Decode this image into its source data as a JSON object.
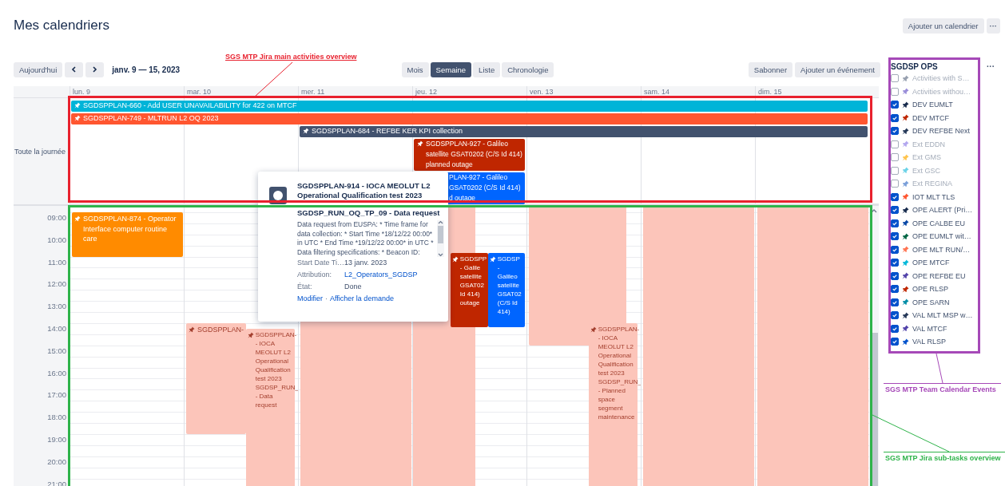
{
  "header": {
    "title": "Mes calendriers",
    "add_calendar": "Ajouter un calendrier",
    "more": "···"
  },
  "toolbar": {
    "today": "Aujourd'hui",
    "range": "janv. 9 — 15, 2023",
    "views": [
      {
        "label": "Mois",
        "selected": false
      },
      {
        "label": "Semaine",
        "selected": true
      },
      {
        "label": "Liste",
        "selected": false
      },
      {
        "label": "Chronologie",
        "selected": false
      }
    ],
    "subscribe": "Sabonner",
    "add_event": "Ajouter un événement"
  },
  "calendar": {
    "all_day_label": "Toute la journée",
    "hours": [
      "09:00",
      "10:00",
      "11:00",
      "12:00",
      "13:00",
      "14:00",
      "15:00",
      "16:00",
      "17:00",
      "18:00",
      "19:00",
      "20:00",
      "21:00"
    ],
    "days": [
      {
        "label": "lun. 9",
        "all_day": [
          {
            "color": "#00b4d8",
            "icon": true,
            "covered": false,
            "continues": true,
            "lines": [
              "SGDSPPLAN-660 - Add USER UNAVAILABILITY for 422 on MTCF"
            ]
          },
          {
            "color": "#ff5630",
            "icon": true,
            "covered": false,
            "continues": true,
            "lines": [
              "SGDSPPLAN-749 - MLTRUN L2 OQ 2023"
            ]
          }
        ],
        "events": [
          {
            "color": "#ff8b00",
            "icon": true,
            "lines": [
              "SGDSPPLAN-874 - Operator",
              "Interface computer routine",
              "care"
            ]
          }
        ]
      },
      {
        "label": "mar. 10",
        "events": [
          {
            "color": "#fcc5ba",
            "icon": true,
            "lines": [
              "SGDSPPLAN-"
            ]
          },
          {
            "color": "#fcc5ba",
            "icon": true,
            "lines": [
              "SGDSPPLAN-",
              "- IOCA",
              "MEOLUT L2",
              "Operational",
              "Qualification",
              "test 2023",
              "SGDSP_RUN_",
              "- Data",
              "request"
            ]
          }
        ]
      },
      {
        "label": "mer. 11",
        "all_day": [
          {
            "color": "#42526e",
            "icon": true,
            "covered": false,
            "continues": true,
            "lines": [
              "SGDSPPLAN-684 - REFBE KER KPI collection"
            ]
          }
        ],
        "events": [
          {
            "color": "#fcc5ba"
          }
        ]
      },
      {
        "label": "jeu. 12",
        "all_day": [
          {
            "color": "#bf2600",
            "icon": true,
            "covered": false,
            "continues": false,
            "lines": [
              "SGDSPPLAN-927 - Galileo",
              "satellite GSAT0202 (C/S Id 414)",
              "planned outage"
            ]
          },
          {
            "color": "#0065ff",
            "icon": false,
            "covered": true,
            "continues": false,
            "lines": [
              "PLAN-927 - Galileo",
              "GSAT0202 (C/S Id 414)",
              "d outage"
            ]
          }
        ],
        "events": [
          {
            "color": "#fcc5ba"
          },
          {
            "color": "#bf2600",
            "icon": true,
            "lines": [
              "SGDSPP",
              "- Galile",
              "satellite",
              "GSAT02",
              "Id 414)",
              "outage"
            ]
          },
          {
            "color": "#0065ff",
            "icon": true,
            "lines": [
              "SGDSP",
              "-",
              "Galileo",
              "satellite",
              "GSAT02",
              "(C/S Id",
              "414)"
            ]
          }
        ]
      },
      {
        "label": "ven. 13",
        "events": [
          {
            "color": "#fcc5ba"
          },
          {
            "color": "#fcc5ba",
            "icon": true,
            "lines": [
              "SGDSPPLAN-",
              "- IOCA",
              "MEOLUT L2",
              "Operational",
              "Qualification",
              "test 2023",
              "SGDSP_RUN_",
              "- Planned",
              "space",
              "segment",
              "maintenance"
            ]
          }
        ]
      },
      {
        "label": "sam. 14",
        "events": [
          {
            "color": "#fcc5ba"
          }
        ]
      },
      {
        "label": "dim. 15",
        "events": [
          {
            "color": "#fcc5ba"
          }
        ]
      }
    ]
  },
  "popup": {
    "title": "SGDSPPLAN-914 - IOCA MEOLUT L2 Operational Qualification test 2023",
    "subtitle": "SGDSP_RUN_OQ_TP_09 - Data request",
    "description": "Data request from EUSPA: * Time frame for data collection: * Start Time *18/12/22 00:00* in UTC * End Time *19/12/22 00:00* in UTC * Data filtering specifications: * Beacon ID:",
    "fields": [
      {
        "label": "Start Date Ti…",
        "value": "13 janv. 2023",
        "kind": "text"
      },
      {
        "label": "Attribution:",
        "value": "L2_Operators_SGDSP",
        "kind": "link"
      },
      {
        "label": "État:",
        "value": "Done",
        "kind": "text"
      }
    ],
    "actions": [
      "Modifier",
      "Afficher la demande"
    ],
    "separator": "·"
  },
  "sidebar": {
    "title": "SGDSP OPS",
    "more": "···",
    "items": [
      {
        "label": "Activities with S…",
        "checked": false,
        "color": "#97a0af"
      },
      {
        "label": "Activities withou…",
        "checked": false,
        "color": "#998dd9"
      },
      {
        "label": "DEV EUMLT",
        "checked": true,
        "color": "#172b4d"
      },
      {
        "label": "DEV MTCF",
        "checked": true,
        "color": "#bf2600"
      },
      {
        "label": "DEV REFBE Next",
        "checked": true,
        "color": "#253858"
      },
      {
        "label": "Ext EDDN",
        "checked": false,
        "color": "#b3a7ef"
      },
      {
        "label": "Ext GMS",
        "checked": false,
        "color": "#ffc44d"
      },
      {
        "label": "Ext GSC",
        "checked": false,
        "color": "#6cd3e8"
      },
      {
        "label": "Ext REGINA",
        "checked": false,
        "color": "#7a9fd9"
      },
      {
        "label": "IOT MLT TLS",
        "checked": true,
        "color": "#ff5630"
      },
      {
        "label": "OPE ALERT (Pri…",
        "checked": true,
        "color": "#172b4d"
      },
      {
        "label": "OPE CALBE EU",
        "checked": true,
        "color": "#0747a6"
      },
      {
        "label": "OPE EUMLT wit…",
        "checked": true,
        "color": "#006644"
      },
      {
        "label": "OPE MLT RUN/…",
        "checked": true,
        "color": "#ff7452"
      },
      {
        "label": "OPE MTCF",
        "checked": true,
        "color": "#00b8d9"
      },
      {
        "label": "OPE REFBE EU",
        "checked": true,
        "color": "#5243aa"
      },
      {
        "label": "OPE RLSP",
        "checked": true,
        "color": "#bf2600"
      },
      {
        "label": "OPE SARN",
        "checked": true,
        "color": "#008da6"
      },
      {
        "label": "VAL MLT MSP w…",
        "checked": true,
        "color": "#253858"
      },
      {
        "label": "VAL MTCF",
        "checked": true,
        "color": "#5243aa"
      },
      {
        "label": "VAL RLSP",
        "checked": true,
        "color": "#0052cc"
      }
    ]
  },
  "annotations": [
    {
      "text": "SGS MTP Jira main activities overview",
      "color": "#e8212e"
    },
    {
      "text": "SGS MTP Team Calendar Events",
      "color": "#a649b8"
    },
    {
      "text": "SGS MTP Jira sub-tasks overview",
      "color": "#2eb34a"
    }
  ]
}
